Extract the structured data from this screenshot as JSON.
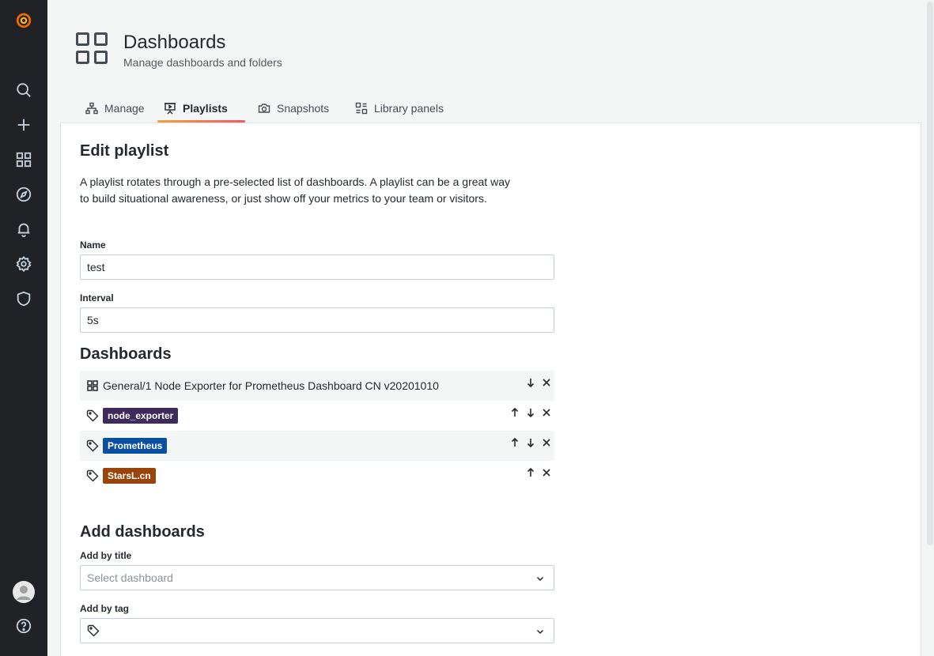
{
  "sidemenu": {
    "items": [
      {
        "name": "logo"
      },
      {
        "name": "search"
      },
      {
        "name": "create"
      },
      {
        "name": "dashboards"
      },
      {
        "name": "explore"
      },
      {
        "name": "alerting"
      },
      {
        "name": "configuration"
      },
      {
        "name": "server-admin"
      },
      {
        "name": "profile"
      },
      {
        "name": "help"
      }
    ]
  },
  "header": {
    "title": "Dashboards",
    "subtitle": "Manage dashboards and folders"
  },
  "tabs": [
    {
      "label": "Manage",
      "icon": "sitemap-icon",
      "active": false
    },
    {
      "label": "Playlists",
      "icon": "presentation-play-icon",
      "active": true
    },
    {
      "label": "Snapshots",
      "icon": "camera-icon",
      "active": false
    },
    {
      "label": "Library panels",
      "icon": "library-panel-icon",
      "active": false
    }
  ],
  "form": {
    "heading": "Edit playlist",
    "description": "A playlist rotates through a pre-selected list of dashboards. A playlist can be a great way to build situational awareness, or just show off your metrics to your team or visitors.",
    "name_label": "Name",
    "name_value": "test",
    "interval_label": "Interval",
    "interval_value": "5s"
  },
  "dashboards": {
    "heading": "Dashboards",
    "items": [
      {
        "type": "dashboard",
        "title": "General/1 Node Exporter for Prometheus Dashboard CN v20201010",
        "up": false,
        "down": true
      },
      {
        "type": "tag",
        "title": "node_exporter",
        "color": "#3f2b5b",
        "up": true,
        "down": true
      },
      {
        "type": "tag",
        "title": "Prometheus",
        "color": "#0a50a1",
        "up": true,
        "down": true
      },
      {
        "type": "tag",
        "title": "StarsL.cn",
        "color": "#99440a",
        "up": true,
        "down": false
      }
    ]
  },
  "add": {
    "heading": "Add dashboards",
    "by_title_label": "Add by title",
    "by_title_placeholder": "Select dashboard",
    "by_tag_label": "Add by tag",
    "by_tag_placeholder": ""
  },
  "colors": {
    "sidebar_bg": "#202226",
    "tab_accent_start": "#f2a33a",
    "tab_accent_end": "#ee5a6a",
    "logo_orange": "#f46800"
  }
}
